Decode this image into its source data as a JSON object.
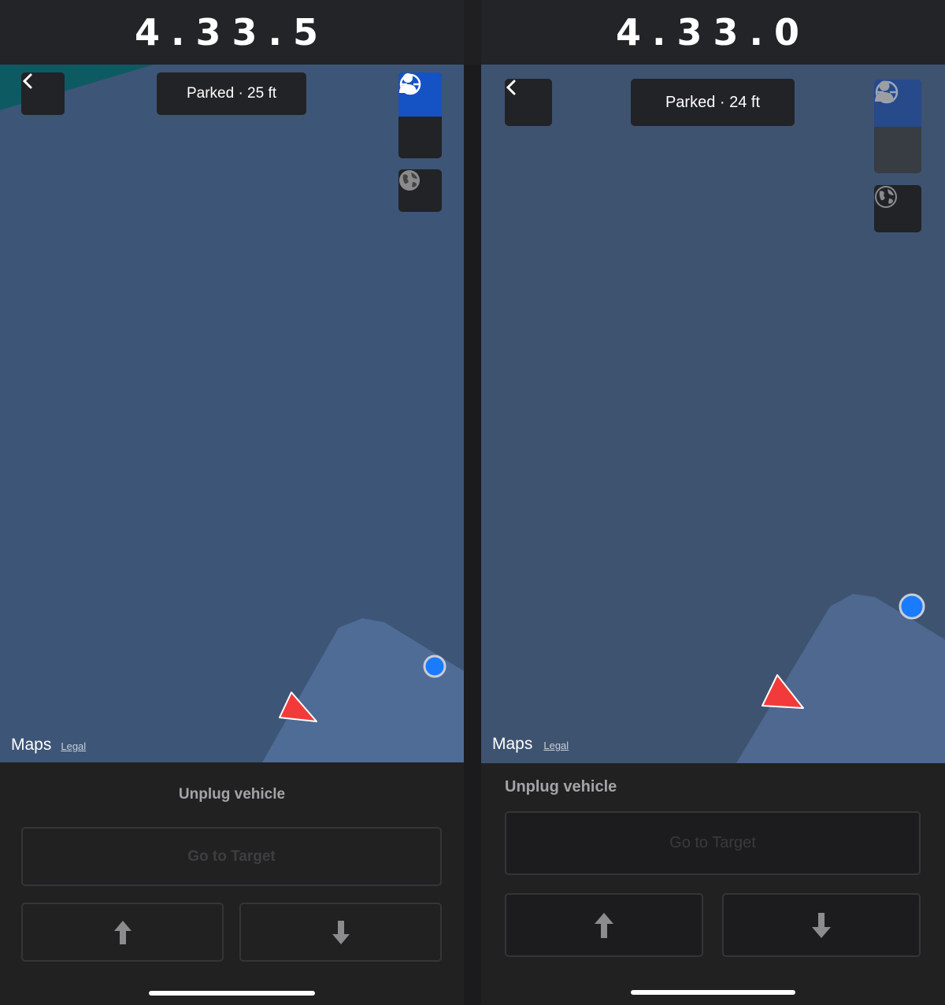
{
  "versions": [
    {
      "label": "4.33.5",
      "status_pill": "Parked · 25 ft",
      "maps_brand": "Maps",
      "legal_link": "Legal",
      "status_text": "Unplug vehicle",
      "go_to_target": "Go to Target"
    },
    {
      "label": "4.33.0",
      "status_pill": "Parked · 24 ft",
      "maps_brand": "Maps",
      "legal_link": "Legal",
      "status_text": "Unplug vehicle",
      "go_to_target": "Go to Target"
    }
  ],
  "icons": {
    "back": "chevron-left-icon",
    "recenter": "crosshair-icon",
    "person": "person-icon",
    "map_type": "globe-icon",
    "up": "arrow-up-icon",
    "down": "arrow-down-icon"
  },
  "colors": {
    "accent": "#1552c4",
    "map_water": "#3d5577",
    "map_land": "#4e6c96",
    "user_dot": "#1a7bff",
    "vehicle_arrow": "#f23a3a"
  }
}
